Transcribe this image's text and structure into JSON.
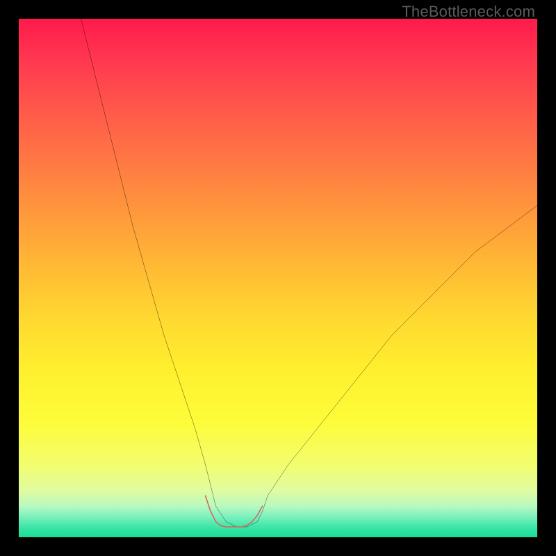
{
  "watermark": {
    "text": "TheBottleneck.com"
  },
  "colors": {
    "page_bg": "#000000",
    "curve_stroke": "#000000",
    "marker_stroke": "#d6675f",
    "watermark": "#5b5b5b"
  },
  "chart_data": {
    "type": "line",
    "title": "",
    "xlabel": "",
    "ylabel": "",
    "xlim": [
      0,
      100
    ],
    "ylim": [
      0,
      100
    ],
    "grid": false,
    "legend": false,
    "note": "V-shaped bottleneck curve descending from top-left, flattening near x≈37–47, then rising toward the right. Values are visual estimates from the image (0–100 normalized).",
    "series": [
      {
        "name": "bottleneck-curve",
        "x": [
          12,
          14,
          16,
          18,
          20,
          22,
          24,
          26,
          28,
          30,
          32,
          34,
          36,
          37,
          38,
          40,
          42,
          44,
          46,
          47,
          48,
          50,
          52,
          56,
          60,
          64,
          68,
          72,
          76,
          80,
          84,
          88,
          92,
          96,
          100
        ],
        "y": [
          100,
          92,
          84,
          76,
          68,
          60,
          53,
          46,
          39,
          33,
          27,
          21,
          14,
          10,
          6,
          3,
          2,
          2,
          3,
          5,
          8,
          11,
          14,
          19,
          24,
          29,
          34,
          39,
          43,
          47,
          51,
          55,
          58,
          61,
          64
        ]
      },
      {
        "name": "optimal-range-marker",
        "x": [
          36,
          37,
          38,
          39,
          40,
          41,
          42,
          43,
          44,
          45,
          46,
          47
        ],
        "y": [
          8,
          5,
          3,
          2.2,
          2,
          2,
          2,
          2,
          2.3,
          3,
          4.2,
          6
        ]
      }
    ]
  }
}
